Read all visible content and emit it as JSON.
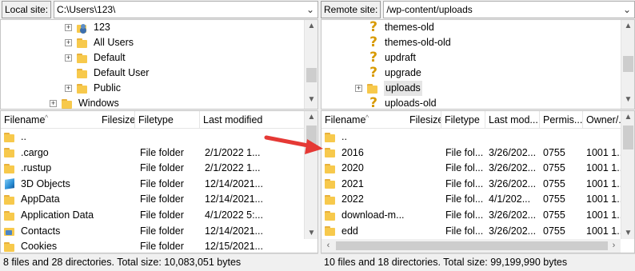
{
  "local": {
    "site_label": "Local site:",
    "path": "C:\\Users\\123\\",
    "tree": [
      {
        "label": "123",
        "icon": "user-folder-icon"
      },
      {
        "label": "All Users",
        "icon": "folder-icon"
      },
      {
        "label": "Default",
        "icon": "folder-icon"
      },
      {
        "label": "Default User",
        "icon": "folder-icon"
      },
      {
        "label": "Public",
        "icon": "folder-icon"
      },
      {
        "label": "Windows",
        "icon": "folder-icon"
      }
    ],
    "columns": [
      "Filename",
      "Filesize",
      "Filetype",
      "Last modified"
    ],
    "rows": [
      {
        "name": "..",
        "size": "",
        "type": "",
        "modified": "",
        "icon": "folder-icon"
      },
      {
        "name": ".cargo",
        "size": "",
        "type": "File folder",
        "modified": "2/1/2022 1...",
        "icon": "folder-icon"
      },
      {
        "name": ".rustup",
        "size": "",
        "type": "File folder",
        "modified": "2/1/2022 1...",
        "icon": "folder-icon"
      },
      {
        "name": "3D Objects",
        "size": "",
        "type": "File folder",
        "modified": "12/14/2021...",
        "icon": "3d-objects-icon"
      },
      {
        "name": "AppData",
        "size": "",
        "type": "File folder",
        "modified": "12/14/2021...",
        "icon": "folder-icon"
      },
      {
        "name": "Application Data",
        "size": "",
        "type": "File folder",
        "modified": "4/1/2022 5:...",
        "icon": "folder-icon"
      },
      {
        "name": "Contacts",
        "size": "",
        "type": "File folder",
        "modified": "12/14/2021...",
        "icon": "contacts-icon"
      },
      {
        "name": "Cookies",
        "size": "",
        "type": "File folder",
        "modified": "12/15/2021...",
        "icon": "folder-icon"
      }
    ],
    "status": "8 files and 28 directories. Total size: 10,083,051 bytes"
  },
  "remote": {
    "site_label": "Remote site:",
    "path": "/wp-content/uploads",
    "tree": [
      {
        "label": "themes-old",
        "icon": "question-mark-icon"
      },
      {
        "label": "themes-old-old",
        "icon": "question-mark-icon"
      },
      {
        "label": "updraft",
        "icon": "question-mark-icon"
      },
      {
        "label": "upgrade",
        "icon": "question-mark-icon"
      },
      {
        "label": "uploads",
        "icon": "folder-icon"
      },
      {
        "label": "uploads-old",
        "icon": "question-mark-icon"
      }
    ],
    "columns": [
      "Filename",
      "Filesize",
      "Filetype",
      "Last mod...",
      "Permis...",
      "Owner/..."
    ],
    "rows": [
      {
        "name": "..",
        "size": "",
        "type": "",
        "modified": "",
        "perms": "",
        "owner": ""
      },
      {
        "name": "2016",
        "size": "",
        "type": "File fol...",
        "modified": "3/26/202...",
        "perms": "0755",
        "owner": "1001 1..."
      },
      {
        "name": "2020",
        "size": "",
        "type": "File fol...",
        "modified": "3/26/202...",
        "perms": "0755",
        "owner": "1001 1..."
      },
      {
        "name": "2021",
        "size": "",
        "type": "File fol...",
        "modified": "3/26/202...",
        "perms": "0755",
        "owner": "1001 1..."
      },
      {
        "name": "2022",
        "size": "",
        "type": "File fol...",
        "modified": "4/1/202...",
        "perms": "0755",
        "owner": "1001 1..."
      },
      {
        "name": "download-m...",
        "size": "",
        "type": "File fol...",
        "modified": "3/26/202...",
        "perms": "0755",
        "owner": "1001 1..."
      },
      {
        "name": "edd",
        "size": "",
        "type": "File fol...",
        "modified": "3/26/202...",
        "perms": "0755",
        "owner": "1001 1..."
      }
    ],
    "status": "10 files and 18 directories. Total size: 99,199,990 bytes"
  },
  "annotation": {
    "arrow_color": "#e53935"
  }
}
